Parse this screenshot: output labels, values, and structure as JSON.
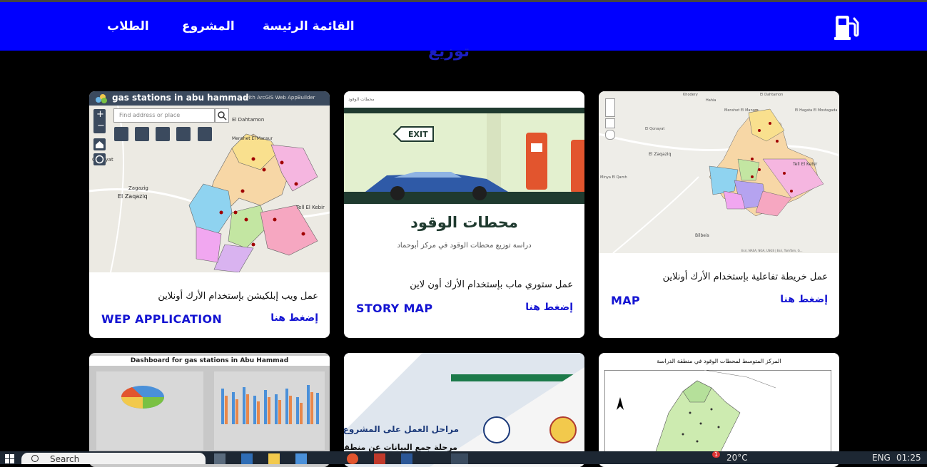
{
  "nav": {
    "home": "القائمة الرئيسة",
    "project": "المشروع",
    "students": "الطلاب"
  },
  "hidden_heading": "توزيع",
  "cards": [
    {
      "description": "عمل خريطة تفاعلية بإستخدام الأرك أونلاين",
      "type": "MAP",
      "action": "إضغط هنا",
      "thumb": {
        "places": [
          "Khodery",
          "Hahia",
          "El Dahtamon",
          "Menshet El Mansur",
          "El Hagata El Mostagada",
          "El Qonayat",
          "El Zaqaziq",
          "Tell El Kebir",
          "Minya El Qamh",
          "Bilbeis"
        ],
        "attribution": "Esri, NASA, NGA, USGS | Esri, TomTom, G..."
      }
    },
    {
      "description": "عمل ستوري ماب بإستخدام الأرك أون لاين",
      "type": "STORY MAP",
      "action": "إضغط هنا",
      "thumb": {
        "header": "محطات الوقود",
        "exit": "EXIT",
        "title": "محطات الوقود",
        "subtitle": "دراسة توزيع محطات الوقود في مركز أبوحماد"
      }
    },
    {
      "description": "عمل ويب إبلكيشن بإستخدام الأرك أونلاين",
      "type": "WEP APPLICATION",
      "action": "إضغط هنا",
      "thumb": {
        "title": "gas stations in abu hammad",
        "builder": "with ArcGIS Web AppBuilder",
        "search_placeholder": "Find address or place",
        "places": [
          "El Dahtamon",
          "Menshet El Mansur",
          "Qenayat",
          "Zagazig",
          "El Zaqaziq",
          "Tell El Kebir"
        ]
      }
    }
  ],
  "row2": {
    "dashboard_title": "Dashboard for gas stations in Abu Hammad",
    "stages_title": "مراحل العمل على المشروع",
    "stages_item": "مرحلة جمع البيانات عن منطقة",
    "map_title": "المركز المتوسط لمحطات الوقود في منطقة الدراسة"
  },
  "taskbar": {
    "search": "Search",
    "weather": "20°C",
    "lang": "ENG",
    "time": "01:25",
    "badge": "1"
  },
  "colors": {
    "nav": "#0000ff",
    "accent": "#1414d2",
    "background": "#000000"
  }
}
